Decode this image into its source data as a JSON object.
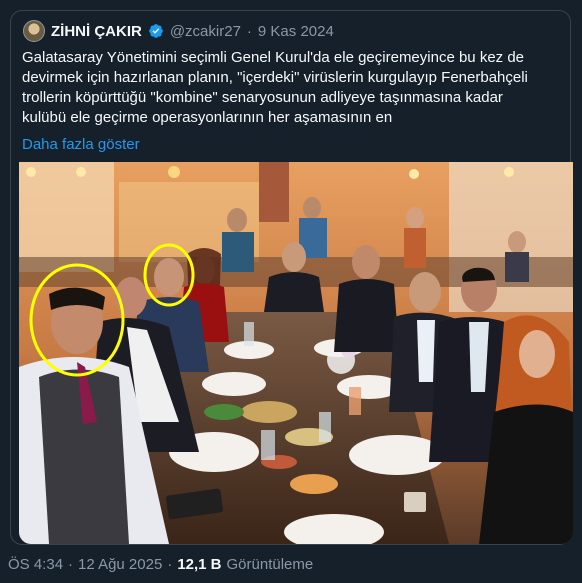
{
  "tweet": {
    "author_name": "ZİHNİ ÇAKIR",
    "handle": "@zcakir27",
    "separator": "·",
    "posted_date": "9 Kas 2024",
    "text_lines": [
      "Galatasaray Yönetimini seçimli Genel Kurul'da ele geçiremeyince bu kez de",
      "devirmek için hazırlanan planın, \"içerdeki\" virüslerin kurgulayıp Fenerbahçeli",
      "trollerin köpürttüğü \"kombine\" senaryosunun adliyeye taşınmasına kadar",
      "kulübü ele geçirme operasyonlarının her aşamasının en"
    ],
    "show_more_label": "Daha fazla göster",
    "accent_color": "#1d9bf0",
    "verified_icon": "verified-badge-icon",
    "image_description_icon": "restaurant-group-photo"
  },
  "footer": {
    "time": "ÖS 4:34",
    "separator": "·",
    "date": "12 Ağu 2025",
    "separator2": "·",
    "views_count": "12,1 B",
    "views_label": "Görüntüleme"
  },
  "colors": {
    "background": "#15202b",
    "text_primary": "#f7f9f9",
    "text_secondary": "#8b98a5",
    "highlight_circle": "#ffff00"
  }
}
